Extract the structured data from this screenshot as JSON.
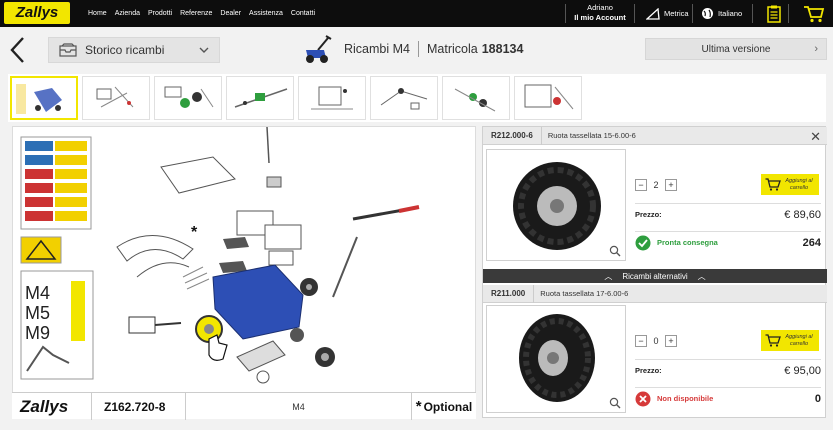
{
  "topbar": {
    "logo": "Zallys",
    "nav": [
      "Home",
      "Azienda",
      "Prodotti",
      "Referenze",
      "Dealer",
      "Assistenza",
      "Contatti"
    ],
    "user_name": "Adriano",
    "account_label": "Il mio Account",
    "metric_label": "Metrica",
    "language_label": "Italiano"
  },
  "header": {
    "history_label": "Storico ricambi",
    "title": "Ricambi M4",
    "serial_label": "Matricola",
    "serial_number": "188134",
    "version_label": "Ultima versione"
  },
  "thumbnails": {
    "count": 8,
    "active_index": 0
  },
  "diagram": {
    "footer": {
      "logo": "Zallys",
      "code": "Z162.720-8",
      "model": "M4",
      "optional_note": "Optional",
      "optional_mark": "*"
    },
    "manual_cover_text": "M4 M5 M9"
  },
  "panel": {
    "primary": {
      "code": "R212.000-6",
      "description": "Ruota tassellata 15-6.00-6",
      "quantity": "2",
      "add_button": "Aggiungi al carrello",
      "price_label": "Prezzo:",
      "price": "€ 89,60",
      "status": "Pronta consegna",
      "status_color": "#2e9e3e",
      "stock": "264"
    },
    "alternatives_label": "Ricambi alternativi",
    "alternative": {
      "code": "R211.000",
      "description": "Ruota tassellata 17-6.00-6",
      "quantity": "0",
      "add_button": "Aggiungi al carrello",
      "price_label": "Prezzo:",
      "price": "€ 95,00",
      "status": "Non disponibile",
      "status_color": "#d63a3a",
      "stock": "0"
    }
  },
  "colors": {
    "brand_yellow": "#f2e600",
    "topbar": "#0d0d0d",
    "part_blue": "#2d4fb5"
  }
}
